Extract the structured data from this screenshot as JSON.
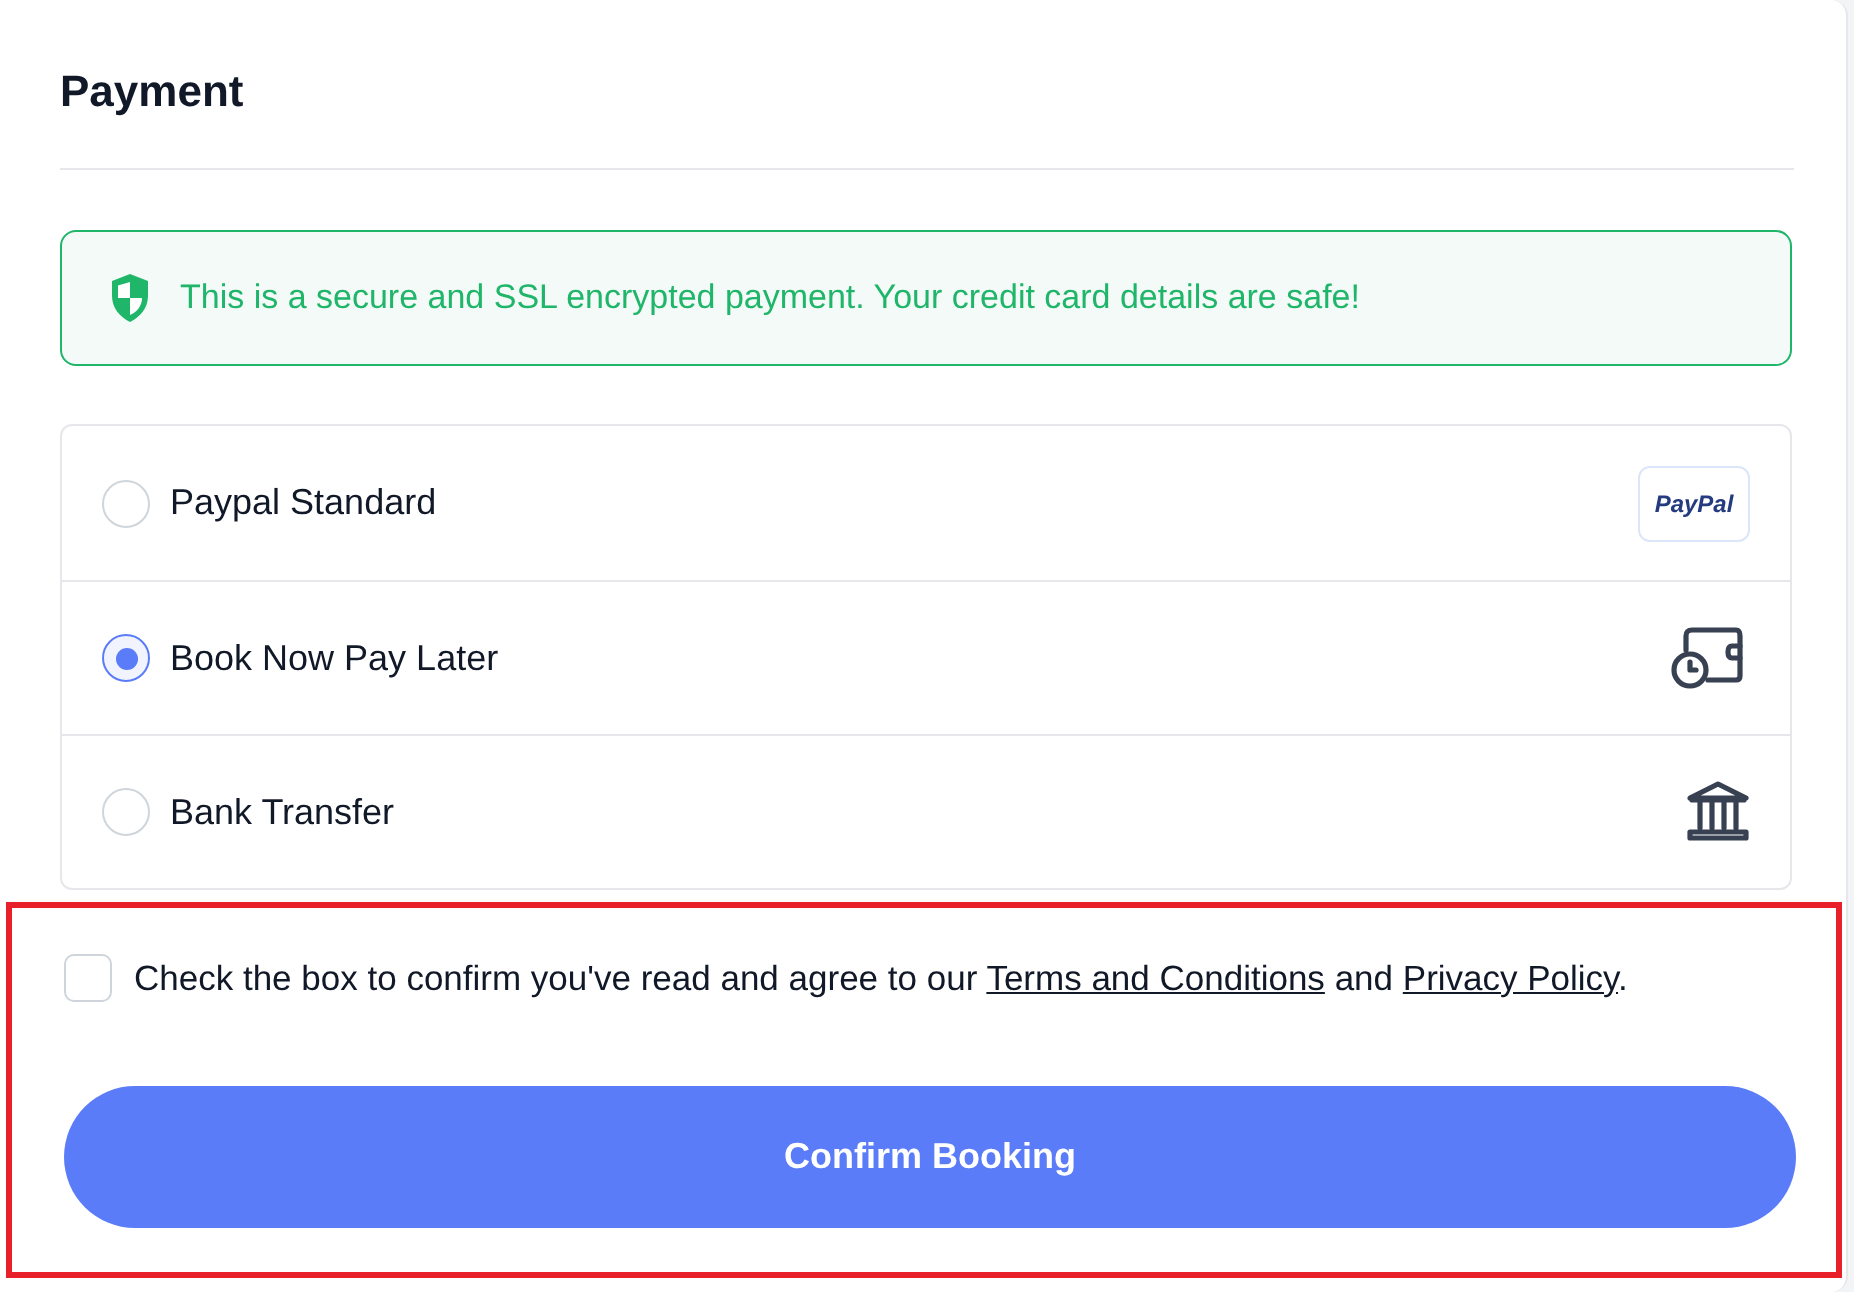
{
  "title": "Payment",
  "notice": {
    "text": "This is a secure and SSL encrypted payment. Your credit card details are safe!"
  },
  "payment_methods": [
    {
      "label": "Paypal Standard",
      "selected": false,
      "kind": "logo",
      "logo_text": "PayPal"
    },
    {
      "label": "Book Now Pay Later",
      "selected": true,
      "kind": "wallet"
    },
    {
      "label": "Bank Transfer",
      "selected": false,
      "kind": "bank"
    }
  ],
  "agreement": {
    "checked": false,
    "text_before": "Check the box to confirm you've read and agree to our",
    "link_1": "Terms and Conditions",
    "text_between": "and",
    "link_2": "Privacy Policy",
    "text_after": "."
  },
  "highlighted": true,
  "confirm_button": "Confirm Booking"
}
